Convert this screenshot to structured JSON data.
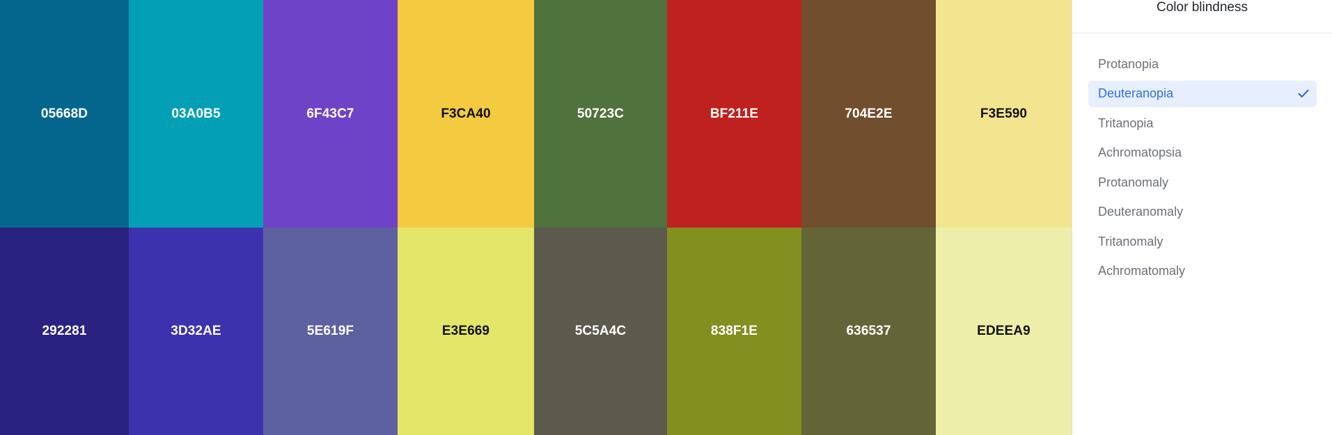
{
  "palette": {
    "rows": [
      [
        {
          "hex": "05668D",
          "bg": "#05668D",
          "fg": "#ffffff"
        },
        {
          "hex": "03A0B5",
          "bg": "#03A0B5",
          "fg": "#ffffff"
        },
        {
          "hex": "6F43C7",
          "bg": "#6F43C7",
          "fg": "#ffffff"
        },
        {
          "hex": "F3CA40",
          "bg": "#F3CA40",
          "fg": "#111111"
        },
        {
          "hex": "50723C",
          "bg": "#50723C",
          "fg": "#ffffff"
        },
        {
          "hex": "BF211E",
          "bg": "#BF211E",
          "fg": "#ffffff"
        },
        {
          "hex": "704E2E",
          "bg": "#704E2E",
          "fg": "#ffffff"
        },
        {
          "hex": "F3E590",
          "bg": "#F3E590",
          "fg": "#111111"
        }
      ],
      [
        {
          "hex": "292281",
          "bg": "#292281",
          "fg": "#ffffff"
        },
        {
          "hex": "3D32AE",
          "bg": "#3D32AE",
          "fg": "#ffffff"
        },
        {
          "hex": "5E619F",
          "bg": "#5E619F",
          "fg": "#ffffff"
        },
        {
          "hex": "E3E669",
          "bg": "#E3E669",
          "fg": "#111111"
        },
        {
          "hex": "5C5A4C",
          "bg": "#5C5A4C",
          "fg": "#ffffff"
        },
        {
          "hex": "838F1E",
          "bg": "#838F1E",
          "fg": "#ffffff"
        },
        {
          "hex": "636537",
          "bg": "#636537",
          "fg": "#ffffff"
        },
        {
          "hex": "EDEEA9",
          "bg": "#EDEEA9",
          "fg": "#111111"
        }
      ]
    ]
  },
  "sidebar": {
    "title": "Color blindness",
    "options": [
      {
        "label": "Protanopia",
        "selected": false
      },
      {
        "label": "Deuteranopia",
        "selected": true
      },
      {
        "label": "Tritanopia",
        "selected": false
      },
      {
        "label": "Achromatopsia",
        "selected": false
      },
      {
        "label": "Protanomaly",
        "selected": false
      },
      {
        "label": "Deuteranomaly",
        "selected": false
      },
      {
        "label": "Tritanomaly",
        "selected": false
      },
      {
        "label": "Achromatomaly",
        "selected": false
      }
    ],
    "check_icon": "check-icon",
    "accent": "#2f6fdb"
  }
}
